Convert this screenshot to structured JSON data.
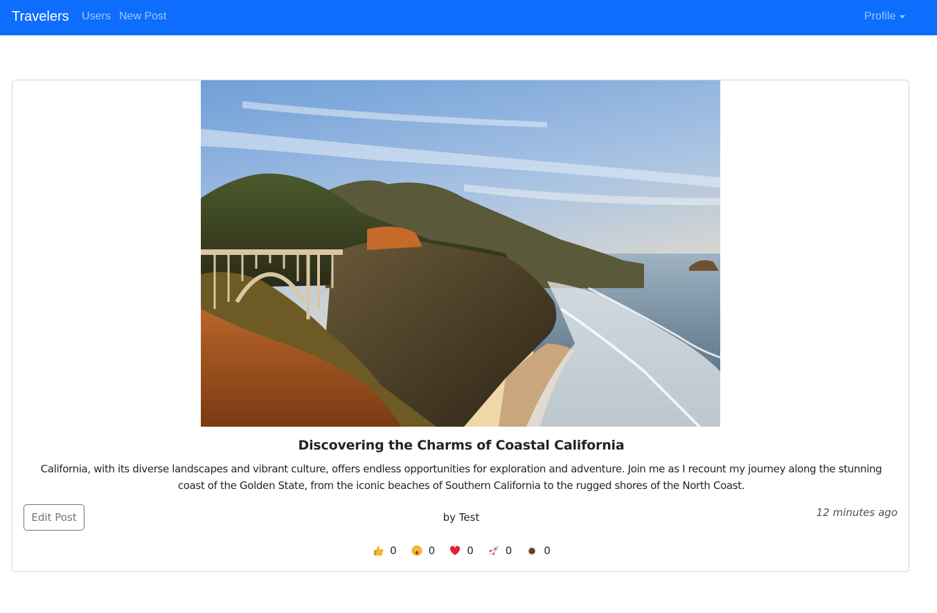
{
  "navbar": {
    "brand": "Travelers",
    "links": [
      "Users",
      "New Post"
    ],
    "profile": "Profile",
    "color": "#0d6efd"
  },
  "post": {
    "image_alt": "Bixby Creek Bridge on the Big Sur coast",
    "title": "Discovering the Charms of Coastal California",
    "body": "California, with its diverse landscapes and vibrant culture, offers endless opportunities for exploration and adventure. Join me as I recount my journey along the stunning coast of the Golden State, from the iconic beaches of Southern California to the rugged shores of the North Coast.",
    "edit_label": "Edit Post",
    "author": "by Test",
    "timestamp": "12 minutes ago"
  },
  "reactions": [
    {
      "icon": "thumbs-up-icon",
      "count": "0"
    },
    {
      "icon": "surprised-face-icon",
      "count": "0"
    },
    {
      "icon": "heart-icon",
      "count": "0"
    },
    {
      "icon": "rocket-icon",
      "count": "0"
    },
    {
      "icon": "coffee-icon",
      "count": "0"
    }
  ]
}
